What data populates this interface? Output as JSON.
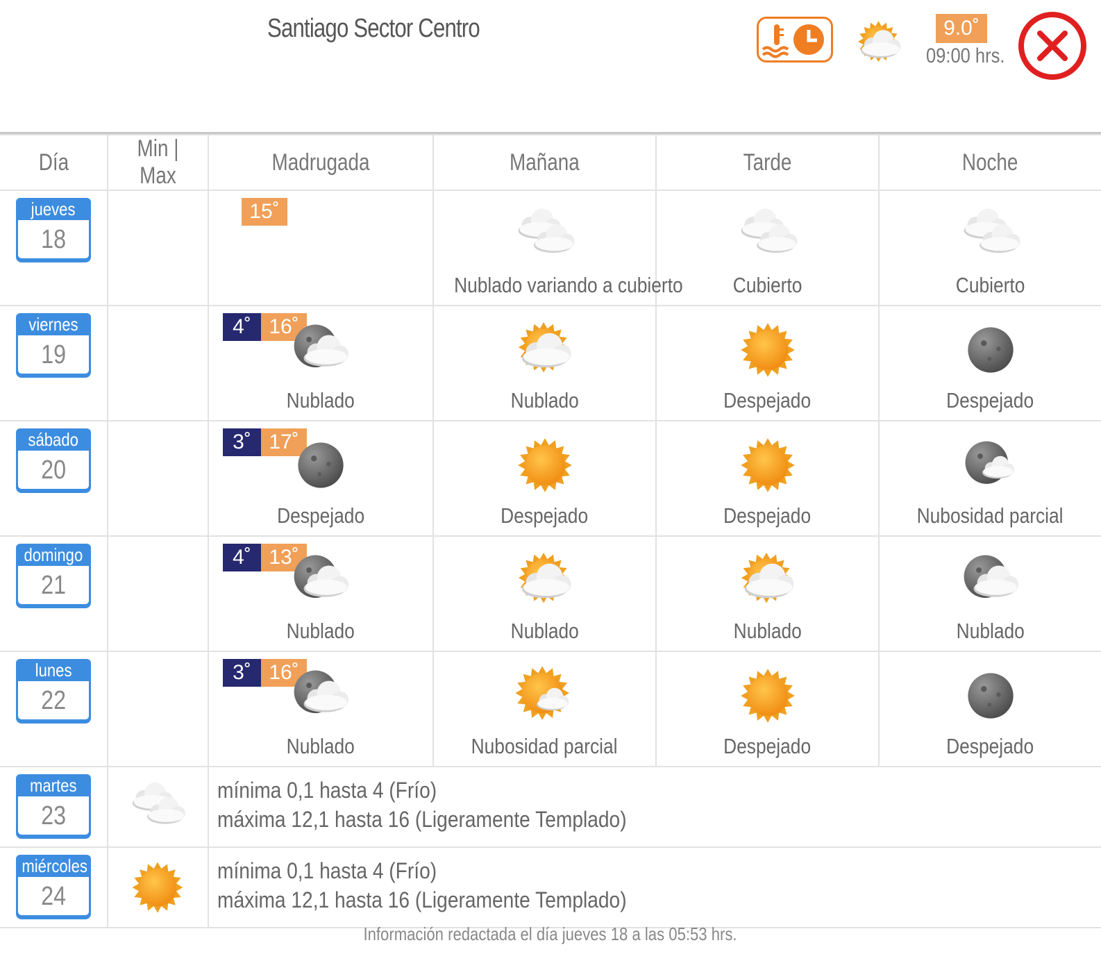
{
  "header": {
    "city": "Santiago Sector Centro",
    "current_temp": "9.0˚",
    "current_time": "09:00 hrs.",
    "current_icon": "partly-cloudy-day-icon",
    "toggle_icon": "temperature-clock-icon",
    "close_icon": "close-icon"
  },
  "columns": [
    "Día",
    "Min | Max",
    "Madrugada",
    "Mañana",
    "Tarde",
    "Noche"
  ],
  "days": [
    {
      "weekday": "jueves",
      "date": "18",
      "min": "",
      "max": "15˚",
      "periods": [
        {
          "icon": "",
          "label": ""
        },
        {
          "icon": "overcast",
          "label": "Nublado variando a cubierto"
        },
        {
          "icon": "overcast",
          "label": "Cubierto"
        },
        {
          "icon": "overcast",
          "label": "Cubierto"
        }
      ]
    },
    {
      "weekday": "viernes",
      "date": "19",
      "min": "4˚",
      "max": "16˚",
      "periods": [
        {
          "icon": "cloudy-night",
          "label": "Nublado"
        },
        {
          "icon": "cloudy-day",
          "label": "Nublado"
        },
        {
          "icon": "sun",
          "label": "Despejado"
        },
        {
          "icon": "moon",
          "label": "Despejado"
        }
      ]
    },
    {
      "weekday": "sábado",
      "date": "20",
      "min": "3˚",
      "max": "17˚",
      "periods": [
        {
          "icon": "moon",
          "label": "Despejado"
        },
        {
          "icon": "sun",
          "label": "Despejado"
        },
        {
          "icon": "sun",
          "label": "Despejado"
        },
        {
          "icon": "partly-night",
          "label": "Nubosidad parcial"
        }
      ]
    },
    {
      "weekday": "domingo",
      "date": "21",
      "min": "4˚",
      "max": "13˚",
      "periods": [
        {
          "icon": "cloudy-night",
          "label": "Nublado"
        },
        {
          "icon": "cloudy-day",
          "label": "Nublado"
        },
        {
          "icon": "cloudy-day",
          "label": "Nublado"
        },
        {
          "icon": "cloudy-night",
          "label": "Nublado"
        }
      ]
    },
    {
      "weekday": "lunes",
      "date": "22",
      "min": "3˚",
      "max": "16˚",
      "periods": [
        {
          "icon": "cloudy-night",
          "label": "Nublado"
        },
        {
          "icon": "partly-day",
          "label": "Nubosidad parcial"
        },
        {
          "icon": "sun",
          "label": "Despejado"
        },
        {
          "icon": "moon",
          "label": "Despejado"
        }
      ]
    }
  ],
  "extended": [
    {
      "weekday": "martes",
      "date": "23",
      "icon": "overcast",
      "line1": "mínima 0,1 hasta 4 (Frío)",
      "line2": "máxima 12,1 hasta 16 (Ligeramente Templado)"
    },
    {
      "weekday": "miércoles",
      "date": "24",
      "icon": "sun",
      "line1": "mínima 0,1 hasta 4 (Frío)",
      "line2": "máxima 12,1 hasta 16 (Ligeramente Templado)"
    }
  ],
  "footer": "Información redactada el día jueves 18 a las 05:53 hrs.",
  "colors": {
    "calendar_blue": "#3c8de0",
    "min_bg": "#262870",
    "max_bg": "#f0a058",
    "close_red": "#e02020",
    "accent_orange": "#ef7d22"
  }
}
